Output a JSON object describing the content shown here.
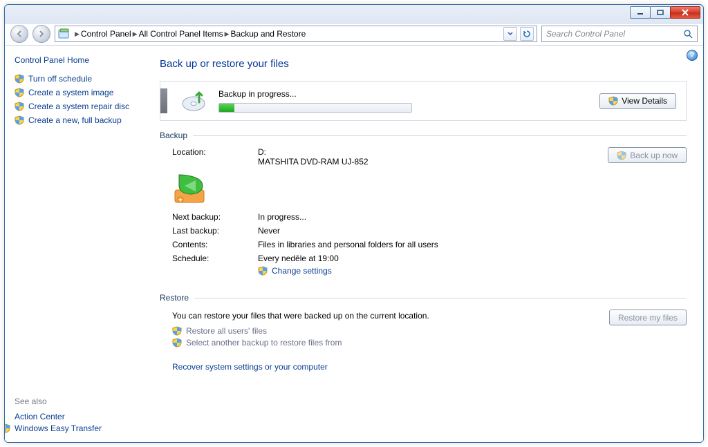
{
  "search": {
    "placeholder": "Search Control Panel"
  },
  "breadcrumb": {
    "items": [
      "Control Panel",
      "All Control Panel Items",
      "Backup and Restore"
    ]
  },
  "sidebar": {
    "home": "Control Panel Home",
    "links": [
      "Turn off schedule",
      "Create a system image",
      "Create a system repair disc",
      "Create a new, full backup"
    ],
    "seealso_label": "See also",
    "seealso_links": [
      "Action Center",
      "Windows Easy Transfer"
    ]
  },
  "page": {
    "title": "Back up or restore your files",
    "progress_label": "Backup in progress...",
    "view_details": "View Details",
    "backup_section": "Backup",
    "restore_section": "Restore",
    "backup_now": "Back up now",
    "location_label": "Location:",
    "location_drive": "D:",
    "location_device": "MATSHITA DVD-RAM UJ-852",
    "next_backup_label": "Next backup:",
    "next_backup_value": "In progress...",
    "last_backup_label": "Last backup:",
    "last_backup_value": "Never",
    "contents_label": "Contents:",
    "contents_value": "Files in libraries and personal folders for all users",
    "schedule_label": "Schedule:",
    "schedule_value": "Every neděle at 19:00",
    "change_settings": "Change settings",
    "restore_text": "You can restore your files that were backed up on the current location.",
    "restore_my_files": "Restore my files",
    "restore_all": "Restore all users' files",
    "select_another": "Select another backup to restore files from",
    "recover": "Recover system settings or your computer"
  }
}
